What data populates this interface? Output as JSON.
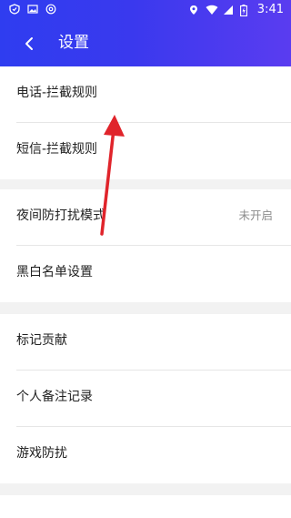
{
  "status_bar": {
    "time": "3:41",
    "left_icons": [
      "shield-icon",
      "image-icon",
      "at-icon"
    ],
    "right_icons": [
      "location-icon",
      "wifi-icon",
      "signal-icon",
      "battery-icon"
    ]
  },
  "header": {
    "title": "设置",
    "back_icon": "chevron-left-icon",
    "gradient": [
      "#2f3df0",
      "#5a3cf0"
    ]
  },
  "groups": [
    {
      "items": [
        {
          "label": "电话-拦截规则"
        },
        {
          "label": "短信-拦截规则"
        }
      ]
    },
    {
      "items": [
        {
          "label": "夜间防打扰模式",
          "value": "未开启"
        },
        {
          "label": "黑白名单设置"
        }
      ]
    },
    {
      "items": [
        {
          "label": "标记贡献"
        },
        {
          "label": "个人备注记录"
        },
        {
          "label": "游戏防扰"
        }
      ]
    }
  ],
  "annotation": {
    "type": "arrow",
    "color": "#e0242b"
  }
}
